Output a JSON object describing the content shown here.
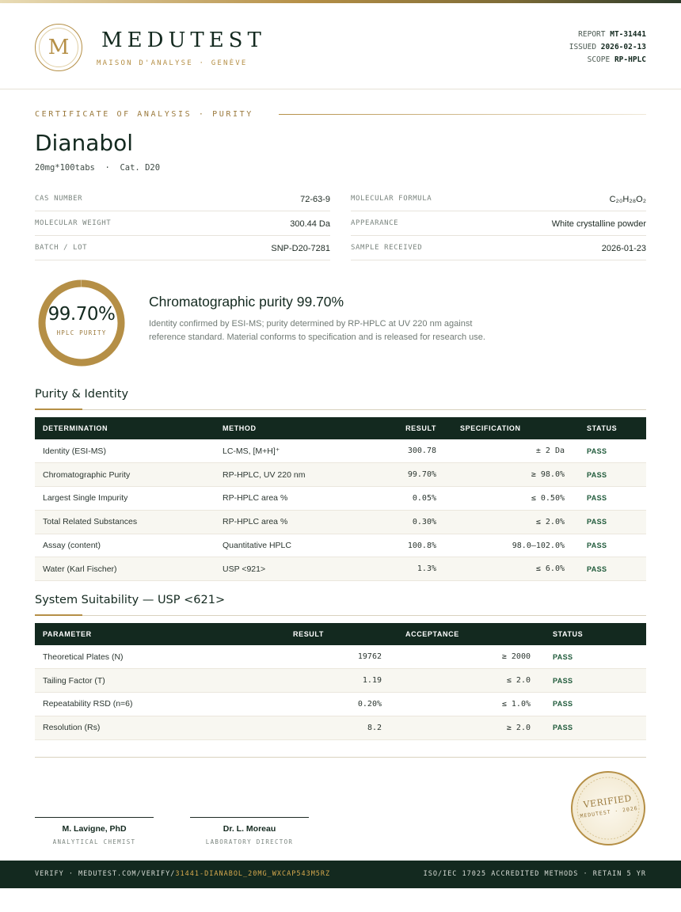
{
  "brand": {
    "logo_letter": "M",
    "name": "MEDUTEST",
    "tagline": "MAISON D'ANALYSE · GENÈVE"
  },
  "report_meta": [
    {
      "label": "REPORT",
      "value": "MT-31441"
    },
    {
      "label": "ISSUED",
      "value": "2026-02-13"
    },
    {
      "label": "SCOPE",
      "value": "RP-HPLC"
    }
  ],
  "certificate": {
    "label": "CERTIFICATE OF ANALYSIS · PURITY",
    "product": "Dianabol",
    "subtitle": "20mg*100tabs  ·  Cat. D20"
  },
  "specs_left": [
    {
      "key": "CAS NUMBER",
      "value": "72-63-9"
    },
    {
      "key": "MOLECULAR WEIGHT",
      "value": "300.44 Da"
    },
    {
      "key": "BATCH / LOT",
      "value": "SNP-D20-7281"
    }
  ],
  "specs_right": [
    {
      "key": "MOLECULAR FORMULA",
      "value": "C₂₀H₂₈O₂"
    },
    {
      "key": "APPEARANCE",
      "value": "White crystalline powder"
    },
    {
      "key": "SAMPLE RECEIVED",
      "value": "2026-01-23"
    }
  ],
  "purity": {
    "value": "99.70%",
    "fraction": 0.997,
    "label": "HPLC PURITY",
    "title": "Chromatographic purity 99.70%",
    "description": "Identity confirmed by ESI-MS; purity determined by RP-HPLC at UV 220 nm against reference standard. Material conforms to specification and is released for research use."
  },
  "identity_section": {
    "title": "Purity & Identity",
    "headers": [
      "DETERMINATION",
      "METHOD",
      "RESULT",
      "SPECIFICATION",
      "STATUS"
    ],
    "rows": [
      [
        "Identity (ESI-MS)",
        "LC-MS, [M+H]⁺",
        "300.78",
        "± 2 Da",
        "PASS"
      ],
      [
        "Chromatographic Purity",
        "RP-HPLC, UV 220 nm",
        "99.70%",
        "≥ 98.0%",
        "PASS"
      ],
      [
        "Largest Single Impurity",
        "RP-HPLC area %",
        "0.05%",
        "≤ 0.50%",
        "PASS"
      ],
      [
        "Total Related Substances",
        "RP-HPLC area %",
        "0.30%",
        "≤ 2.0%",
        "PASS"
      ],
      [
        "Assay (content)",
        "Quantitative HPLC",
        "100.8%",
        "98.0–102.0%",
        "PASS"
      ],
      [
        "Water (Karl Fischer)",
        "USP <921>",
        "1.3%",
        "≤ 6.0%",
        "PASS"
      ]
    ]
  },
  "suitability_section": {
    "title": "System Suitability — USP <621>",
    "headers": [
      "PARAMETER",
      "RESULT",
      "ACCEPTANCE",
      "STATUS"
    ],
    "rows": [
      [
        "Theoretical Plates (N)",
        "19762",
        "≥ 2000",
        "PASS"
      ],
      [
        "Tailing Factor (T)",
        "1.19",
        "≤ 2.0",
        "PASS"
      ],
      [
        "Repeatability RSD (n=6)",
        "0.20%",
        "≤ 1.0%",
        "PASS"
      ],
      [
        "Resolution (Rs)",
        "8.2",
        "≥ 2.0",
        "PASS"
      ]
    ]
  },
  "signatures": [
    {
      "name": "M. Lavigne, PhD",
      "role": "ANALYTICAL CHEMIST"
    },
    {
      "name": "Dr. L. Moreau",
      "role": "LABORATORY DIRECTOR"
    }
  ],
  "seal": {
    "main": "VERIFIED",
    "sub": "MEDUTEST · 2026"
  },
  "footer": {
    "verify_prefix": "VERIFY · MEDUTEST.COM/VERIFY/",
    "verify_code": "31441-DIANABOL_20MG_WXCAP543M5RZ",
    "right": "ISO/IEC 17025 ACCREDITED METHODS · RETAIN 5 YR"
  },
  "colors": {
    "gold": "#b58f46",
    "dark_green": "#13291f",
    "pass_green": "#1f5a3a"
  }
}
